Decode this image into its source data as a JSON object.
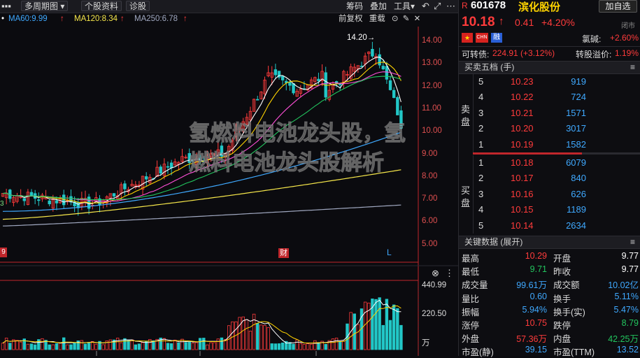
{
  "toolbar": {
    "period_label": "多周期图",
    "stock_info_label": "个股资料",
    "diagnosis_label": "诊股",
    "chips_label": "筹码",
    "overlay_label": "叠加",
    "tools_label": "工具",
    "adjust_label": "前复权",
    "reset_label": "重载"
  },
  "ma": {
    "ma60": "MA60:9.99",
    "ma60_arrow": "↑",
    "ma120": "MA120:8.34",
    "ma120_arrow": "↑",
    "ma250": "MA250:6.78",
    "ma250_arrow": "↑"
  },
  "chart": {
    "price_ticks": [
      "14.00",
      "13.00",
      "12.00",
      "11.00",
      "10.00",
      "9.00",
      "8.00",
      "7.00",
      "6.00",
      "5.00"
    ],
    "high_marker": "14.20→",
    "volume_ticks": [
      "440.99",
      "220.50",
      "万"
    ],
    "event_badges": [
      "财",
      "L"
    ],
    "left_badge": "9",
    "left_value": "3"
  },
  "header": {
    "market_tag": "R",
    "code": "601678",
    "name": "滨化股份",
    "add_self": "加自选",
    "price": "10.18",
    "price_arrow": "↑",
    "change": "0.41",
    "change_pct": "+4.20%",
    "status": "闭市",
    "flag_cn": "CHN",
    "tag_rong": "融",
    "sector": "氯碱:",
    "sector_pct": "+2.60%",
    "conv_label": "可转债:",
    "conv_value": "224.91 (+3.12%)",
    "premium_label": "转股溢价:",
    "premium_value": "1.19%"
  },
  "orderbook": {
    "title": "买卖五档 (手)",
    "sell_label": [
      "卖",
      "盘"
    ],
    "buy_label": [
      "买",
      "盘"
    ],
    "sell": [
      {
        "n": "5",
        "price": "10.23",
        "vol": "919"
      },
      {
        "n": "4",
        "price": "10.22",
        "vol": "724"
      },
      {
        "n": "3",
        "price": "10.21",
        "vol": "1571"
      },
      {
        "n": "2",
        "price": "10.20",
        "vol": "3017"
      },
      {
        "n": "1",
        "price": "10.19",
        "vol": "1582"
      }
    ],
    "buy": [
      {
        "n": "1",
        "price": "10.18",
        "vol": "6079"
      },
      {
        "n": "2",
        "price": "10.17",
        "vol": "840"
      },
      {
        "n": "3",
        "price": "10.16",
        "vol": "626"
      },
      {
        "n": "4",
        "price": "10.15",
        "vol": "1189"
      },
      {
        "n": "5",
        "price": "10.14",
        "vol": "2634"
      }
    ]
  },
  "keydata": {
    "title": "关键数据 (展开)",
    "rows": [
      {
        "l1": "最高",
        "v1": "10.29",
        "c1": "red",
        "l2": "开盘",
        "v2": "9.77",
        "c2": "white"
      },
      {
        "l1": "最低",
        "v1": "9.71",
        "c1": "green",
        "l2": "昨收",
        "v2": "9.77",
        "c2": "white"
      },
      {
        "l1": "成交量",
        "v1": "99.61万",
        "c1": "blue",
        "l2": "成交额",
        "v2": "10.02亿",
        "c2": "blue"
      },
      {
        "l1": "量比",
        "v1": "0.60",
        "c1": "blue",
        "l2": "换手",
        "v2": "5.11%",
        "c2": "blue"
      },
      {
        "l1": "振幅",
        "v1": "5.94%",
        "c1": "blue",
        "l2": "换手(实)",
        "v2": "5.47%",
        "c2": "blue"
      },
      {
        "l1": "涨停",
        "v1": "10.75",
        "c1": "red",
        "l2": "跌停",
        "v2": "8.79",
        "c2": "green"
      },
      {
        "l1": "外盘",
        "v1": "57.36万",
        "c1": "red",
        "l2": "内盘",
        "v2": "42.25万",
        "c2": "green"
      },
      {
        "l1": "市盈(静)",
        "v1": "39.15",
        "c1": "blue",
        "l2": "市盈(TTM)",
        "v2": "13.52",
        "c2": "blue"
      }
    ]
  },
  "watermark": {
    "line1": "氢燃料电池龙头股，氢",
    "line2": "燃料电池龙头股解析"
  },
  "colors": {
    "up": "#ff3b3b",
    "down": "#22c7c7",
    "ma5": "#ffffff",
    "ma10": "#ffd400",
    "ma20": "#ff4fd8",
    "ma30": "#22c55e",
    "ma60": "#3fa9ff",
    "ma120": "#f5e64a",
    "ma250": "#a0a8c0"
  }
}
